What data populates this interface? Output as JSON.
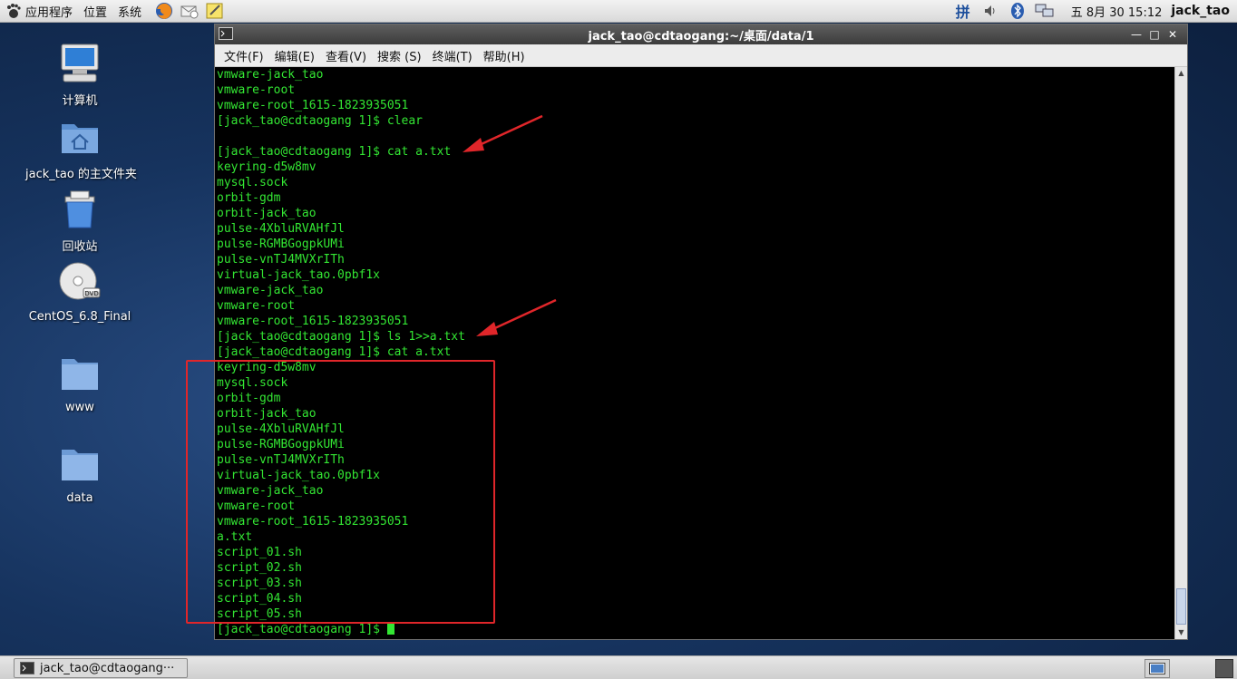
{
  "top_panel": {
    "menus": [
      "应用程序",
      "位置",
      "系统"
    ],
    "clock": "五 8月 30 15:12",
    "user": "jack_tao",
    "ime_label": "拼"
  },
  "desktop_icons": [
    {
      "label": "计算机",
      "icon": "computer-icon"
    },
    {
      "label": "jack_tao 的主文件夹",
      "icon": "home-folder-icon"
    },
    {
      "label": "回收站",
      "icon": "trash-icon"
    },
    {
      "label": "CentOS_6.8_Final",
      "icon": "dvd-icon"
    },
    {
      "label": "www",
      "icon": "folder-icon"
    },
    {
      "label": "data",
      "icon": "folder-icon"
    }
  ],
  "window": {
    "title": "jack_tao@cdtaogang:~/桌面/data/1",
    "menu": [
      "文件(F)",
      "编辑(E)",
      "查看(V)",
      "搜索 (S)",
      "终端(T)",
      "帮助(H)"
    ],
    "terminal_lines": [
      "vmware-jack_tao",
      "vmware-root",
      "vmware-root_1615-1823935051",
      "[jack_tao@cdtaogang 1]$ clear",
      "",
      "[jack_tao@cdtaogang 1]$ cat a.txt",
      "keyring-d5w8mv",
      "mysql.sock",
      "orbit-gdm",
      "orbit-jack_tao",
      "pulse-4XbluRVAHfJl",
      "pulse-RGMBGogpkUMi",
      "pulse-vnTJ4MVXrITh",
      "virtual-jack_tao.0pbf1x",
      "vmware-jack_tao",
      "vmware-root",
      "vmware-root_1615-1823935051",
      "[jack_tao@cdtaogang 1]$ ls 1>>a.txt",
      "[jack_tao@cdtaogang 1]$ cat a.txt",
      "keyring-d5w8mv",
      "mysql.sock",
      "orbit-gdm",
      "orbit-jack_tao",
      "pulse-4XbluRVAHfJl",
      "pulse-RGMBGogpkUMi",
      "pulse-vnTJ4MVXrITh",
      "virtual-jack_tao.0pbf1x",
      "vmware-jack_tao",
      "vmware-root",
      "vmware-root_1615-1823935051",
      "a.txt",
      "script_01.sh",
      "script_02.sh",
      "script_03.sh",
      "script_04.sh",
      "script_05.sh"
    ],
    "prompt": "[jack_tao@cdtaogang 1]$ "
  },
  "taskbar": {
    "task_label": "jack_tao@cdtaogang···"
  },
  "colors": {
    "terminal_text": "#33e633",
    "terminal_bg": "#000000",
    "annotation": "#e0262a"
  }
}
